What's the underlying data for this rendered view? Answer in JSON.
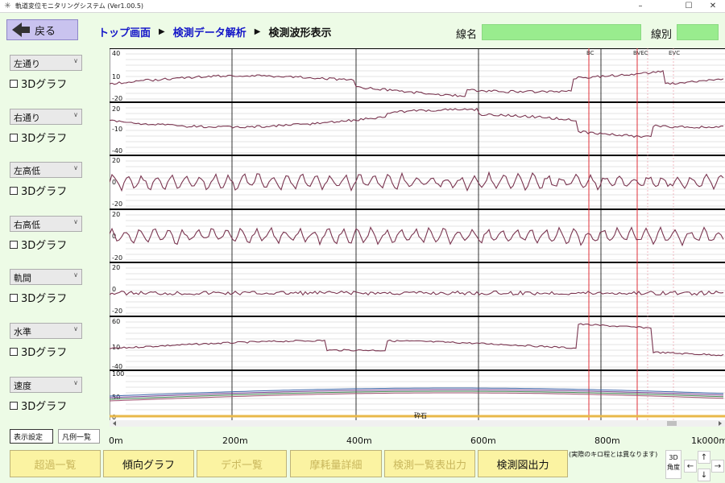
{
  "window": {
    "title": "軌道変位モニタリングシステム (Ver1.00.5)",
    "minimize": "–",
    "maximize": "☐",
    "close": "✕"
  },
  "header": {
    "back_label": "戻る",
    "crumbs": [
      "トップ画面",
      "検測データ解析",
      "検測波形表示"
    ],
    "sep": "▶",
    "line_name_label": "線名",
    "line_name_value": "",
    "line_type_label": "線別",
    "line_type_value": ""
  },
  "channels": [
    {
      "select": "左通り",
      "graph3d": "3Dグラフ",
      "ticks": [
        "40",
        "10",
        "-20"
      ]
    },
    {
      "select": "右通り",
      "graph3d": "3Dグラフ",
      "ticks": [
        "20",
        "-10",
        "-40"
      ]
    },
    {
      "select": "左高低",
      "graph3d": "3Dグラフ",
      "ticks": [
        "20",
        "0",
        "-20"
      ]
    },
    {
      "select": "右高低",
      "graph3d": "3Dグラフ",
      "ticks": [
        "20",
        "0",
        "-20"
      ]
    },
    {
      "select": "軌間",
      "graph3d": "3Dグラフ",
      "ticks": [
        "20",
        "0",
        "-20"
      ]
    },
    {
      "select": "水準",
      "graph3d": "3Dグラフ",
      "ticks": [
        "60",
        "10",
        "-40"
      ]
    },
    {
      "select": "速度",
      "graph3d": "3Dグラフ",
      "ticks": [
        "100",
        "50",
        "0"
      ]
    }
  ],
  "chart_data": {
    "type": "line",
    "x_unit": "m",
    "x_ticks": [
      "0m",
      "200m",
      "400m",
      "600m",
      "800m",
      "1k000m"
    ],
    "markers": [
      "BC",
      "BVEC",
      "EVC"
    ],
    "band_label": "砕石"
  },
  "buttons": {
    "display_settings": "表示設定",
    "legend_list": "凡例一覧",
    "excess_list": "超過一覧",
    "trend_graph": "傾向グラフ",
    "depot_list": "デポ一覧",
    "wear_detail": "摩耗量詳細",
    "measure_table": "検測一覧表出力",
    "measure_chart": "検測図出力"
  },
  "footnote": "(実際のキロ程とは異なります)",
  "angle": {
    "label_3d": "3D",
    "label_angle": "角度",
    "up": "↑",
    "down": "↓",
    "left": "←",
    "right": "→"
  },
  "colors": {
    "bg": "#edfbe6",
    "accent_blue": "#1416c8",
    "field_green": "#99ec8e",
    "button_yellow": "#fbf3a2",
    "trace": "#7a3550",
    "marker_red": "#e0303a"
  }
}
